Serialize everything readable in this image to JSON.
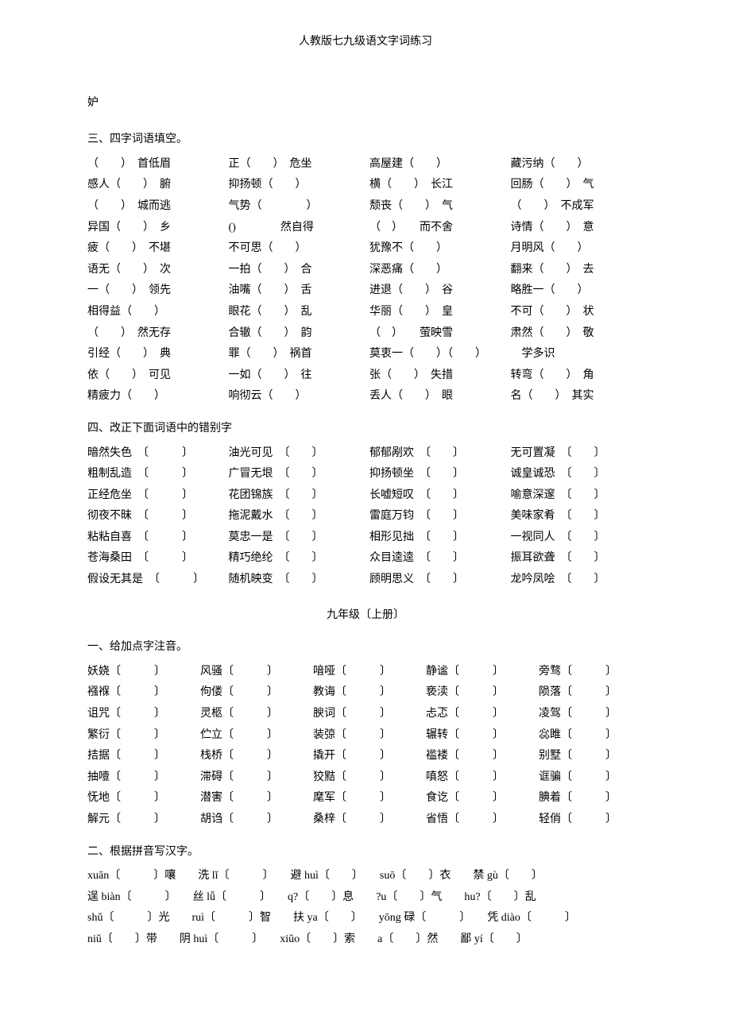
{
  "title": "人教版七九级语文字词练习",
  "char1": "妒",
  "sec3_head": "三、四字词语填空。",
  "sec3": [
    [
      "（　　）　首低眉",
      "正（　　）　危坐",
      "高屋建（　　）",
      "藏污纳（　　）"
    ],
    [
      "感人（　　）　腑",
      "抑扬顿（　　）",
      "横（　　）　长江",
      "回肠（　　）　气"
    ],
    [
      "（　　）　城而逃",
      "气势（　　　　）",
      "颓丧（　　）　气",
      "（　　）　不成军"
    ],
    [
      "异国（　　）　乡",
      "()　　　　然自得",
      "（　）　　而不舍",
      "诗情（　　）　意"
    ],
    [
      "疲（　　）　不堪",
      "不可思（　　）",
      "犹豫不（　　）",
      "月明风（　　）"
    ],
    [
      "语无（　　）　次",
      "一拍（　　）　合",
      "深恶痛（　　）",
      "翻来（　　）　去"
    ],
    [
      "一（　　）　领先",
      "油嘴（　　）　舌",
      "进退（　　）　谷",
      "略胜一（　　）"
    ],
    [
      "相得益（　　）",
      "眼花（　　）　乱",
      "华丽（　　）　皇",
      "不可（　　）　状"
    ],
    [
      "（　　）　然无存",
      "合辙（　　）　韵",
      "（　）　　萤映雪",
      "肃然（　　）　敬"
    ],
    [
      "引经（　　）　典",
      "罪（　　）　祸首",
      "莫衷一（　　）（　　）",
      "　学多识"
    ],
    [
      "依（　　）　可见",
      "一如（　　）　往",
      "张（　　）　失措",
      "转弯（　　）　角"
    ],
    [
      "精疲力（　　）",
      "响彻云（　　）",
      "丢人（　　）　眼",
      "名（　　）　其实"
    ]
  ],
  "sec4_head": "四、改正下面词语中的错别字",
  "sec4": [
    [
      "暗然失色　〔　　　〕",
      "油光可见　〔　　〕",
      "郁郁剐欢　〔　　〕",
      "无可置凝　〔　　〕"
    ],
    [
      "粗制乱造　〔　　　〕",
      "广冒无垠　〔　　〕",
      "抑扬顿坐　〔　　〕",
      "诚皇诚恐　〔　　〕"
    ],
    [
      "正经危坐　〔　　　〕",
      "花团锦族　〔　　〕",
      "长嘘短叹　〔　　〕",
      "喻意深邃　〔　　〕"
    ],
    [
      "彻夜不昧　〔　　　〕",
      "拖泥戴水　〔　　〕",
      "雷庭万钧　〔　　〕",
      "美味家肴　〔　　〕"
    ],
    [
      "粘粘自喜　〔　　　〕",
      "莫忠一是　〔　　〕",
      "相形见拙　〔　　〕",
      "一视同人　〔　　〕"
    ],
    [
      "苍海桑田　〔　　　〕",
      "精巧绝纶　〔　　〕",
      "众目逵逵　〔　　〕",
      "振耳欲聋　〔　　〕"
    ],
    [
      "假设无其是　〔　　　〕",
      "随机映变　〔　　〕",
      "顾明思义　〔　　〕",
      "龙吟凤哙　〔　　〕"
    ]
  ],
  "mid_title": "九年级〔上册〕",
  "sec5_head": "一、给加点字注音。",
  "sec5": [
    [
      "妖娆〔　　　〕",
      "风骚〔　　　〕",
      "喑哑〔　　　〕",
      "静谧〔　　　〕",
      "旁骛〔　　　〕"
    ],
    [
      "襁褓〔　　　〕",
      "佝偻〔　　　〕",
      "教诲〔　　　〕",
      "亵渎〔　　　〕",
      "陨落〔　　　〕"
    ],
    [
      "诅咒〔　　　〕",
      "灵柩〔　　　〕",
      "腴词〔　　　〕",
      "忐忑〔　　　〕",
      "凌驾〔　　　〕"
    ],
    [
      "繁衍〔　　　〕",
      "伫立〔　　　〕",
      "装弶〔　　　〕",
      "辗转〔　　　〕",
      "惢睢〔　　　〕"
    ],
    [
      "拮据〔　　　〕",
      "栈桥〔　　　〕",
      "撬开〔　　　〕",
      "褴褛〔　　　〕",
      "别墅〔　　　〕"
    ],
    [
      "抽噎〔　　　〕",
      "滞碍〔　　　〕",
      "狡黠〔　　　〕",
      "嗔怒〔　　　〕",
      "诓骗〔　　　〕"
    ],
    [
      "怃地〔　　　〕",
      "潜害〔　　　〕",
      "麾军〔　　　〕",
      "食讫〔　　　〕",
      "腆着〔　　　〕"
    ],
    [
      "解元〔　　　〕",
      "胡诌〔　　　〕",
      "桑梓〔　　　〕",
      "省悟〔　　　〕",
      "轻俏〔　　　〕"
    ]
  ],
  "sec6_head": "二、根据拼音写汉字。",
  "sec6_lines": [
    "xuān〔　　　〕嚷　　洗 lǐ〔　　　〕　　避 huì〔　　〕　　suō〔　　〕衣　　禁 gù〔　　〕",
    "逞 biàn〔　　　〕　　丝 lǚ〔　　　〕　　q?〔　　〕息　　?u〔　　〕气　　hu?〔　　〕乱",
    "shǔ〔　　　〕光　　ruì〔　　　〕智　　扶 ya〔　　〕　　yōng 碌〔　　　〕　　凭 diào〔　　　〕",
    "niǔ〔　　〕带　　阴 huì〔　　　〕　　xiǔo〔　　〕索　　a〔　　〕然　　鄙 yí〔　　〕"
  ]
}
